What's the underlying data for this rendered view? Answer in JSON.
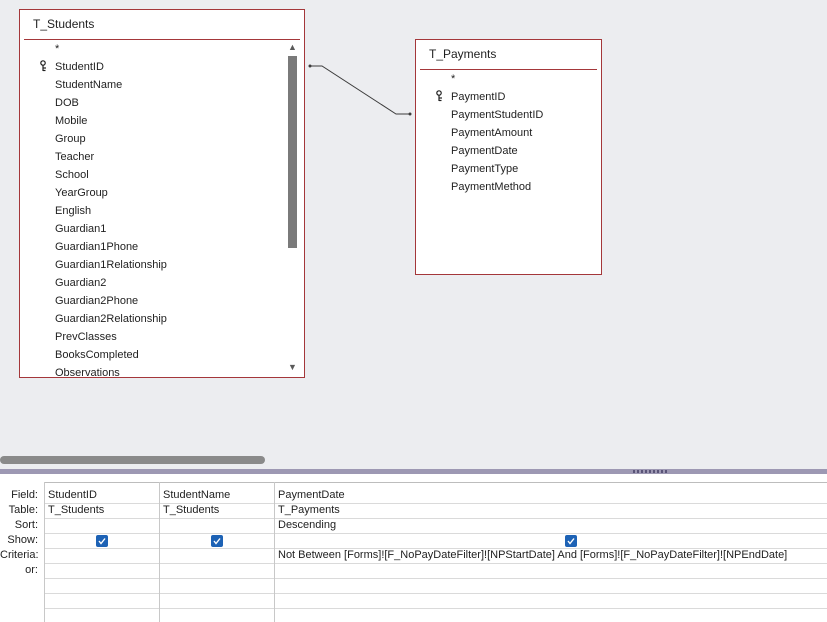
{
  "tables": [
    {
      "name": "T_Students",
      "fields": [
        "*",
        "StudentID",
        "StudentName",
        "DOB",
        "Mobile",
        "Group",
        "Teacher",
        "School",
        "YearGroup",
        "English",
        "Guardian1",
        "Guardian1Phone",
        "Guardian1Relationship",
        "Guardian2",
        "Guardian2Phone",
        "Guardian2Relationship",
        "PrevClasses",
        "BooksCompleted",
        "Observations"
      ],
      "key_field": "StudentID"
    },
    {
      "name": "T_Payments",
      "fields": [
        "*",
        "PaymentID",
        "PaymentStudentID",
        "PaymentAmount",
        "PaymentDate",
        "PaymentType",
        "PaymentMethod"
      ],
      "key_field": "PaymentID"
    }
  ],
  "grid": {
    "row_labels": [
      "Field:",
      "Table:",
      "Sort:",
      "Show:",
      "Criteria:",
      "or:"
    ],
    "columns": [
      {
        "field": "StudentID",
        "table": "T_Students",
        "sort": "",
        "show": true,
        "criteria": ""
      },
      {
        "field": "StudentName",
        "table": "T_Students",
        "sort": "",
        "show": true,
        "criteria": ""
      },
      {
        "field": "PaymentDate",
        "table": "T_Payments",
        "sort": "Descending",
        "show": true,
        "criteria": "Not Between [Forms]![F_NoPayDateFilter]![NPStartDate] And [Forms]![F_NoPayDateFilter]![NPEndDate]"
      }
    ]
  },
  "colors": {
    "table_border": "#a4373a",
    "checkbox": "#1d62b5",
    "splitter": "#9d98b3"
  }
}
